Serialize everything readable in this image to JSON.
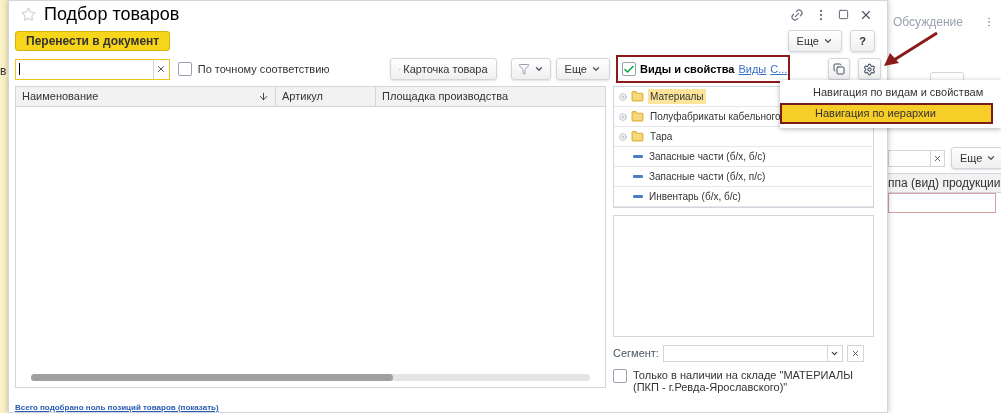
{
  "background": {
    "left_text": "в",
    "panel_title": "Обсуждение",
    "more_button": "Еще",
    "column_header": "ппа (вид) продукции"
  },
  "window": {
    "title": "Подбор товаров",
    "favorite": false
  },
  "toolbar": {
    "transfer_button": "Перенести в документ",
    "more_button": "Еще",
    "help_button": "?"
  },
  "search": {
    "exact_match": {
      "label": "По точному соответствию",
      "checked": false
    }
  },
  "card_button": "Карточка товара",
  "list_more_button": "Еще",
  "kinds_panel": {
    "enabled": true,
    "label": "Виды и свойства",
    "links": [
      "Виды",
      "С..."
    ]
  },
  "table": {
    "columns": [
      {
        "label": "Наименование",
        "sorted": true
      },
      {
        "label": "Артикул",
        "sorted": false
      },
      {
        "label": "Площадка производства",
        "sorted": false
      }
    ]
  },
  "footer_link": "Всего подобрано ноль позиций товаров (показать)",
  "tree": {
    "items": [
      {
        "label": "Материалы",
        "kind": "group",
        "selected": true
      },
      {
        "label": "Полуфабрикаты кабельного",
        "kind": "group",
        "selected": false
      },
      {
        "label": "Тара",
        "kind": "group",
        "selected": false
      },
      {
        "label": "Запасные части (б/х, б/с)",
        "kind": "item",
        "selected": false
      },
      {
        "label": "Запасные части (б/х, п/с)",
        "kind": "item",
        "selected": false
      },
      {
        "label": "Инвентарь (б/х, б/с)",
        "kind": "item",
        "selected": false
      }
    ]
  },
  "segment": {
    "label": "Сегмент:"
  },
  "stock_only": {
    "label": "Только в наличии на складе \"МАТЕРИАЛЫ (ПКП - г.Ревда-Ярославского)\"",
    "checked": false
  },
  "menu": {
    "items": [
      {
        "label": "Навигация по видам и свойствам",
        "selected": false
      },
      {
        "label": "Навигация по иерархии",
        "selected": true
      }
    ]
  }
}
